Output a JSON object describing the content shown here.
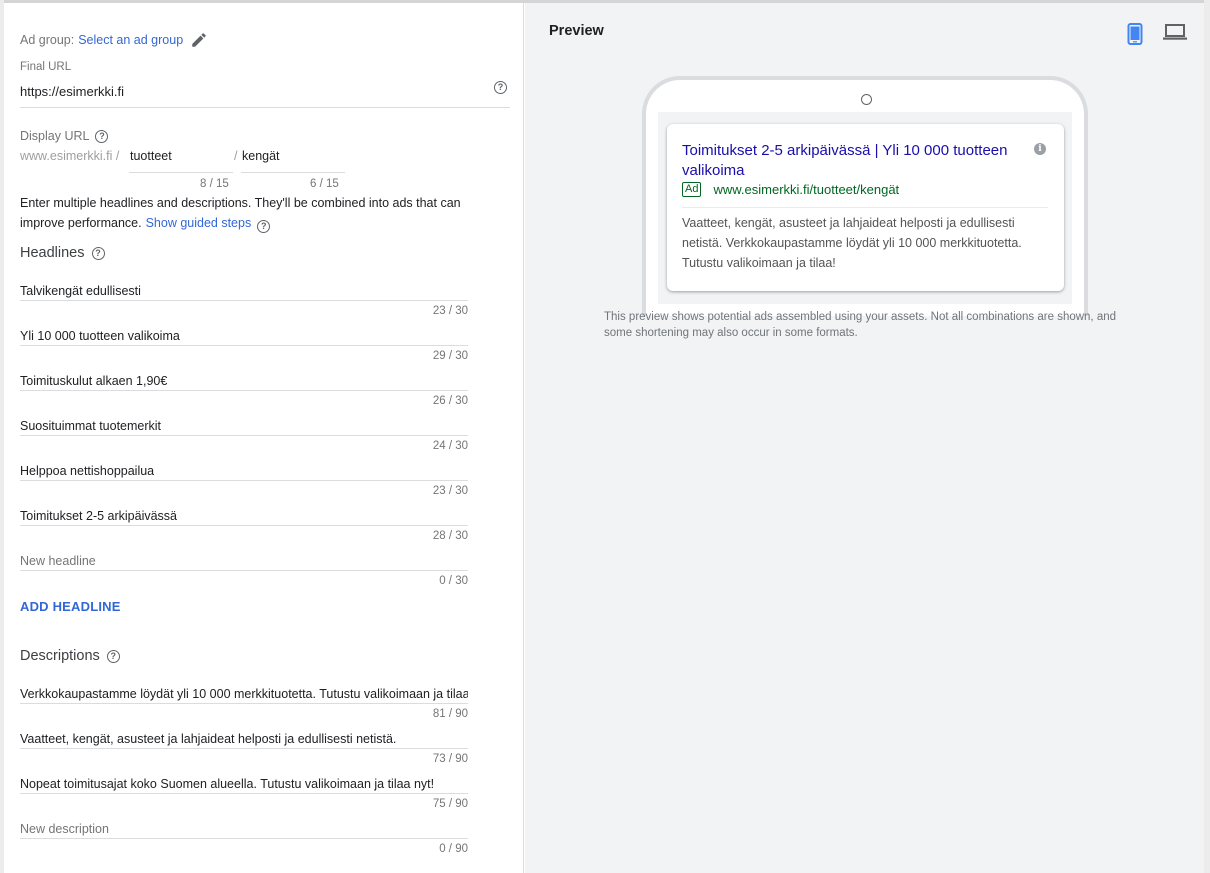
{
  "ad_group": {
    "label": "Ad group:",
    "link": "Select an ad group",
    "edit_icon": "pencil-icon"
  },
  "final_url": {
    "label": "Final URL",
    "value": "https://esimerkki.fi",
    "help_icon": "help-icon"
  },
  "display_url": {
    "label": "Display URL",
    "base": "www.esimerkki.fi /",
    "separator": "/",
    "path1": "tuotteet",
    "path1_count": "8 / 15",
    "path2": "kengät",
    "path2_count": "6 / 15"
  },
  "info": {
    "text": "Enter multiple headlines and descriptions. They'll be combined into ads that can improve performance.",
    "link": "Show guided steps"
  },
  "headlines": {
    "title": "Headlines",
    "items": [
      {
        "value": "Talvikengät edullisesti",
        "count": "23 / 30"
      },
      {
        "value": "Yli 10 000 tuotteen valikoima",
        "count": "29 / 30"
      },
      {
        "value": "Toimituskulut alkaen 1,90€",
        "count": "26 / 30"
      },
      {
        "value": "Suosituimmat tuotemerkit",
        "count": "24 / 30"
      },
      {
        "value": "Helppoa nettishoppailua",
        "count": "23 / 30"
      },
      {
        "value": "Toimitukset 2-5 arkipäivässä",
        "count": "28 / 30"
      }
    ],
    "new_placeholder": "New headline",
    "new_count": "0 / 30",
    "add_label": "ADD HEADLINE"
  },
  "descriptions": {
    "title": "Descriptions",
    "items": [
      {
        "value": "Verkkokaupastamme löydät yli 10 000 merkkituotetta. Tutustu valikoimaan ja tilaa!",
        "count": "81 / 90"
      },
      {
        "value": "Vaatteet, kengät, asusteet ja lahjaideat helposti ja edullisesti netistä.",
        "count": "73 / 90"
      },
      {
        "value": "Nopeat toimitusajat koko Suomen alueella. Tutustu valikoimaan ja tilaa nyt!",
        "count": "75 / 90"
      }
    ],
    "new_placeholder": "New description",
    "new_count": "0 / 90"
  },
  "preview": {
    "title": "Preview",
    "mobile_icon": "mobile-phone-icon",
    "desktop_icon": "laptop-icon",
    "accent_color": "#4285f4",
    "ad": {
      "headline": "Toimitukset 2-5 arkipäivässä | Yli 10 000 tuotteen valikoima",
      "badge": "Ad",
      "url": "www.esimerkki.fi/tuotteet/kengät",
      "description": "Vaatteet, kengät, asusteet ja lahjaideat helposti ja edullisesti netistä. Verkkokaupastamme löydät yli 10 000 merkkituotetta. Tutustu valikoimaan ja tilaa!",
      "info_icon": "info-icon"
    },
    "note": "This preview shows potential ads assembled using your assets. Not all combinations are shown, and some shortening may also occur in some formats."
  }
}
